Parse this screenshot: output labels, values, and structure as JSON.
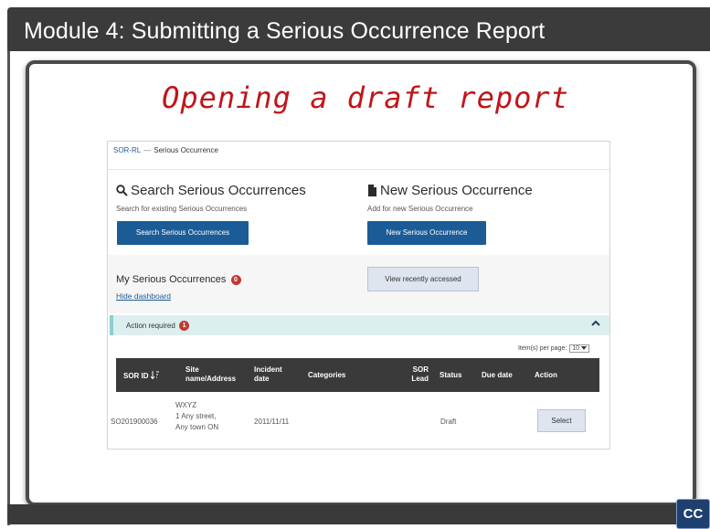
{
  "slide": {
    "title": "Module 4:  Submitting a Serious Occurrence Report",
    "heading": "Opening a draft report",
    "cc_label": "CC"
  },
  "app": {
    "breadcrumb": {
      "root": "SOR-RL",
      "separator": "—",
      "current": "Serious Occurrence"
    },
    "search": {
      "title": "Search Serious Occurrences",
      "subtitle": "Search for existing Serious Occurrences",
      "button": "Search Serious Occurrences"
    },
    "new_so": {
      "title": "New Serious Occurrence",
      "subtitle": "Add for new Serious Occurrence",
      "button": "New Serious Occurrence"
    },
    "my_so": {
      "title": "My Serious Occurrences",
      "badge": "0",
      "hide_link": "Hide dashboard",
      "recent_button": "View recently accessed"
    },
    "action_required": {
      "label": "Action required",
      "badge": "1"
    },
    "pager": {
      "label": "Item(s) per page:",
      "value": "10"
    },
    "table": {
      "headers": {
        "sor_id": "SOR ID",
        "site": "Site name/Address",
        "incident": "Incident date",
        "categories": "Categories",
        "lead": "SOR Lead",
        "status": "Status",
        "due": "Due date",
        "action": "Action"
      },
      "row": {
        "sor_id": "SO201900036",
        "site_name": "WXYZ",
        "address1": "1 Any street,",
        "address2": "Any town ON",
        "incident_date": "2011/11/11",
        "categories": "",
        "lead": "",
        "status": "Draft",
        "due_date": "",
        "action": "Select"
      }
    }
  },
  "colors": {
    "heading": "#c0151a",
    "primary_button": "#1b5c96",
    "table_header": "#3a3a3a",
    "badge": "#c23934",
    "action_bar": "#ddeeee"
  }
}
